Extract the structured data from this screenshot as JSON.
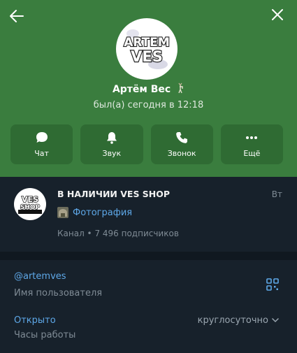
{
  "profile": {
    "name": "Артём Вес",
    "status": "был(а) сегодня в 12:18",
    "avatar_text_top": "ARTEM",
    "avatar_text_bottom": "VES"
  },
  "actions": [
    {
      "label": "Чат",
      "icon": "chat-icon"
    },
    {
      "label": "Звук",
      "icon": "bell-icon"
    },
    {
      "label": "Звонок",
      "icon": "phone-icon"
    },
    {
      "label": "Ещё",
      "icon": "more-icon"
    }
  ],
  "channel": {
    "title": "В НАЛИЧИИ VES SHOP",
    "day": "Вт",
    "subtitle": "Фотография",
    "meta": "Канал • 7 496 подписчиков",
    "avatar_text": "VES SHOP"
  },
  "info": {
    "username": "@artemves",
    "username_label": "Имя пользователя",
    "hours_status": "Открыто",
    "hours_label": "Часы работы",
    "hours_value": "круглосуточно"
  },
  "colors": {
    "header": "#3a7d3e",
    "button": "#2f6b33",
    "background": "#17212b",
    "link": "#5ea8e8",
    "muted": "#7f8b95"
  }
}
